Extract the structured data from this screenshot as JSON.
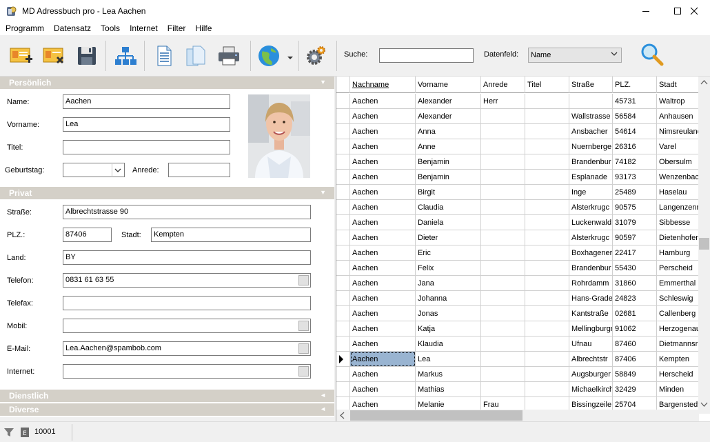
{
  "window": {
    "title": "MD Adressbuch pro - Lea Aachen"
  },
  "menu": [
    "Programm",
    "Datensatz",
    "Tools",
    "Internet",
    "Filter",
    "Hilfe"
  ],
  "toolbar": {
    "search_label": "Suche:",
    "search_value": "",
    "datenfeld_label": "Datenfeld:",
    "datenfeld_value": "Name"
  },
  "sections": {
    "persoenlich": "Persönlich",
    "privat": "Privat",
    "dienstlich": "Dienstlich",
    "diverse": "Diverse"
  },
  "persoenlich": {
    "name_label": "Name:",
    "name": "Aachen",
    "vorname_label": "Vorname:",
    "vorname": "Lea",
    "titel_label": "Titel:",
    "titel": "",
    "geburtstag_label": "Geburtstag:",
    "geburtstag": "",
    "anrede_label": "Anrede:",
    "anrede": ""
  },
  "privat": {
    "strasse_label": "Straße:",
    "strasse": "Albrechtstrasse 90",
    "plz_label": "PLZ.:",
    "plz": "87406",
    "stadt_label": "Stadt:",
    "stadt": "Kempten",
    "land_label": "Land:",
    "land": "BY",
    "telefon_label": "Telefon:",
    "telefon": "0831 61 63 55",
    "telefax_label": "Telefax:",
    "telefax": "",
    "mobil_label": "Mobil:",
    "mobil": "",
    "email_label": "E-Mail:",
    "email": "Lea.Aachen@spambob.com",
    "internet_label": "Internet:",
    "internet": ""
  },
  "grid": {
    "columns": [
      "Nachname",
      "Vorname",
      "Anrede",
      "Titel",
      "Straße",
      "PLZ.",
      "Stadt"
    ],
    "rows": [
      [
        "Aachen",
        "Alexander",
        "Herr",
        "",
        "",
        "45731",
        "Waltrop"
      ],
      [
        "Aachen",
        "Alexander",
        "",
        "",
        "Wallstrasse",
        "56584",
        "Anhausen"
      ],
      [
        "Aachen",
        "Anna",
        "",
        "",
        "Ansbacher",
        "54614",
        "Nimsreuland"
      ],
      [
        "Aachen",
        "Anne",
        "",
        "",
        "Nuernberge",
        "26316",
        "Varel"
      ],
      [
        "Aachen",
        "Benjamin",
        "",
        "",
        "Brandenbur",
        "74182",
        "Obersulm"
      ],
      [
        "Aachen",
        "Benjamin",
        "",
        "",
        "Esplanade",
        "93173",
        "Wenzenbach"
      ],
      [
        "Aachen",
        "Birgit",
        "",
        "",
        "Inge",
        "25489",
        "Haselau"
      ],
      [
        "Aachen",
        "Claudia",
        "",
        "",
        "Alsterkrugc",
        "90575",
        "Langenzenn"
      ],
      [
        "Aachen",
        "Daniela",
        "",
        "",
        "Luckenwald",
        "31079",
        "Sibbesse"
      ],
      [
        "Aachen",
        "Dieter",
        "",
        "",
        "Alsterkrugc",
        "90597",
        "Dietenhofen"
      ],
      [
        "Aachen",
        "Eric",
        "",
        "",
        "Boxhagener",
        "22417",
        "Hamburg"
      ],
      [
        "Aachen",
        "Felix",
        "",
        "",
        "Brandenbur",
        "55430",
        "Perscheid"
      ],
      [
        "Aachen",
        "Jana",
        "",
        "",
        "Rohrdamm",
        "31860",
        "Emmerthal"
      ],
      [
        "Aachen",
        "Johanna",
        "",
        "",
        "Hans-Grade",
        "24823",
        "Schleswig"
      ],
      [
        "Aachen",
        "Jonas",
        "",
        "",
        "Kantstraße",
        "02681",
        "Callenberg"
      ],
      [
        "Aachen",
        "Katja",
        "",
        "",
        "Mellingburgr",
        "91062",
        "Herzogenaurach"
      ],
      [
        "Aachen",
        "Klaudia",
        "",
        "",
        "Ufnau",
        "87460",
        "Dietmannsried"
      ],
      [
        "Aachen",
        "Lea",
        "",
        "",
        "Albrechtstr",
        "87406",
        "Kempten"
      ],
      [
        "Aachen",
        "Markus",
        "",
        "",
        "Augsburger",
        "58849",
        "Herscheid"
      ],
      [
        "Aachen",
        "Mathias",
        "",
        "",
        "Michaelkirch",
        "32429",
        "Minden"
      ],
      [
        "Aachen",
        "Melanie",
        "Frau",
        "",
        "Bissingzeile",
        "25704",
        "Bargenstedt"
      ]
    ],
    "selected_row": 17
  },
  "status": {
    "count": "10001"
  }
}
